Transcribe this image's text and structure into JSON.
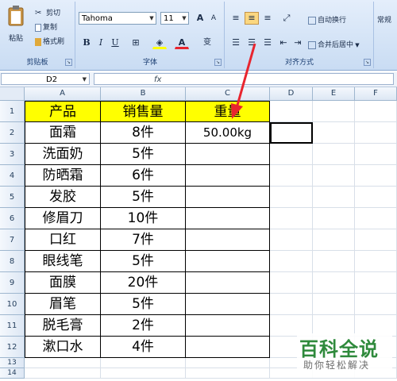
{
  "ribbon": {
    "clipboard": {
      "paste": "粘贴",
      "cut": "剪切",
      "copy": "复制",
      "format_painter": "格式刷",
      "group_label": "剪贴板"
    },
    "font": {
      "name": "Tahoma",
      "size": "11",
      "grow": "A",
      "shrink": "A",
      "bold": "B",
      "italic": "I",
      "underline": "U",
      "font_color": "A",
      "phonetic": "变",
      "group_label": "字体"
    },
    "alignment": {
      "wrap_text": "自动换行",
      "merge_center": "合并后居中",
      "group_label": "对齐方式"
    },
    "number": {
      "format": "常规"
    }
  },
  "formula_bar": {
    "name_box": "D2",
    "fx": "fx",
    "value": ""
  },
  "columns": [
    "A",
    "B",
    "C",
    "D",
    "E",
    "F"
  ],
  "rows": [
    "1",
    "2",
    "3",
    "4",
    "5",
    "6",
    "7",
    "8",
    "9",
    "10",
    "11",
    "12",
    "13",
    "14"
  ],
  "sheet": {
    "header": [
      "产品",
      "销售量",
      "重量"
    ],
    "data": [
      [
        "面霜",
        "8件",
        "50.00kg"
      ],
      [
        "洗面奶",
        "5件",
        ""
      ],
      [
        "防晒霜",
        "6件",
        ""
      ],
      [
        "发胶",
        "5件",
        ""
      ],
      [
        "修眉刀",
        "10件",
        ""
      ],
      [
        "口红",
        "7件",
        ""
      ],
      [
        "眼线笔",
        "5件",
        ""
      ],
      [
        "面膜",
        "20件",
        ""
      ],
      [
        "眉笔",
        "5件",
        ""
      ],
      [
        "脱毛膏",
        "2件",
        ""
      ],
      [
        "漱口水",
        "4件",
        ""
      ]
    ]
  },
  "colors": {
    "header_fill": "#ffff00",
    "annotation_arrow": "#e8252f",
    "watermark": "#2f8a3c"
  },
  "watermark": {
    "title": "百科全说",
    "subtitle": "助你轻松解决"
  }
}
